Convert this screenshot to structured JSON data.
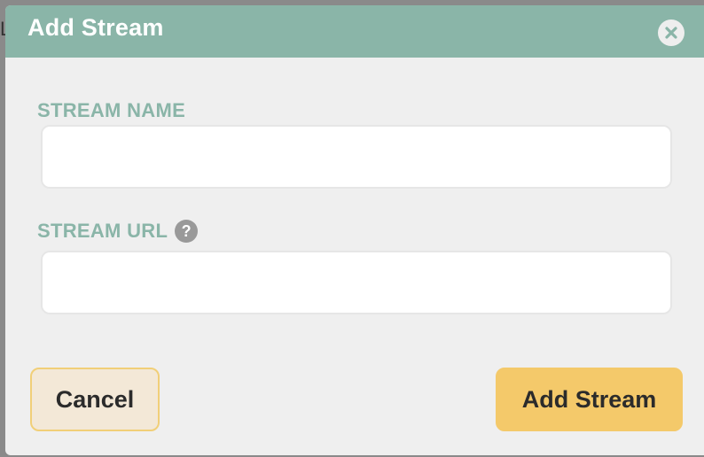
{
  "dialog": {
    "title": "Add Stream",
    "close_icon": "close-icon"
  },
  "form": {
    "stream_name": {
      "label": "STREAM NAME",
      "value": "",
      "placeholder": ""
    },
    "stream_url": {
      "label": "STREAM URL",
      "help_icon": "help-icon",
      "help_glyph": "?",
      "value": "",
      "placeholder": ""
    }
  },
  "actions": {
    "cancel_label": "Cancel",
    "submit_label": "Add Stream"
  },
  "colors": {
    "header": "#8ab5a8",
    "label": "#8ab5a8",
    "primary": "#f4c96a",
    "secondary_bg": "#f3e8d7",
    "secondary_border": "#f1cf78",
    "modal_bg": "#efefef"
  }
}
